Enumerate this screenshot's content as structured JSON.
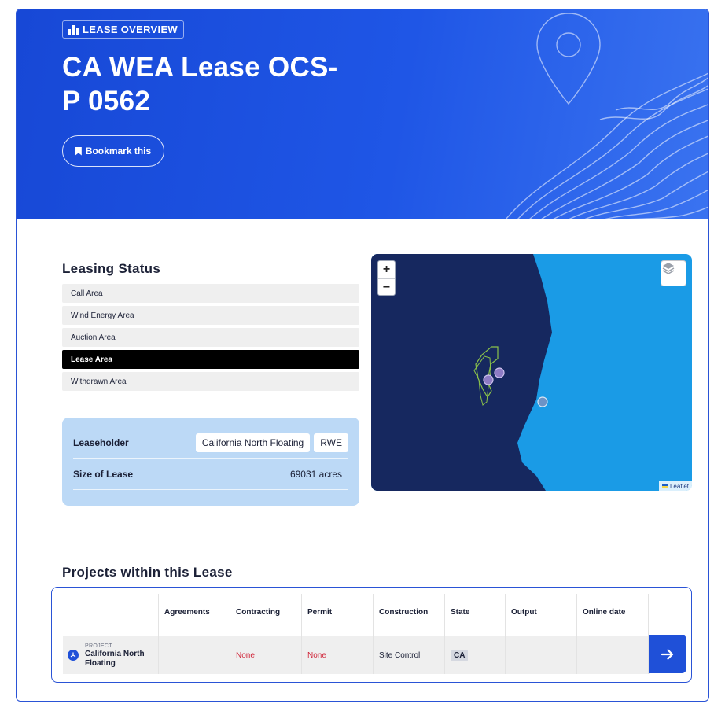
{
  "hero": {
    "chip_label": "LEASE OVERVIEW",
    "title_line1": "CA WEA Lease OCS-",
    "title_line2": "P 0562",
    "bookmark_label": "Bookmark this"
  },
  "leasing_status": {
    "title": "Leasing Status",
    "items": [
      {
        "label": "Call Area",
        "active": false
      },
      {
        "label": "Wind Energy Area",
        "active": false
      },
      {
        "label": "Auction Area",
        "active": false
      },
      {
        "label": "Lease Area",
        "active": true
      },
      {
        "label": "Withdrawn Area",
        "active": false
      }
    ]
  },
  "lease_info": {
    "leaseholder_label": "Leaseholder",
    "leaseholders": [
      "California North Floating",
      "RWE"
    ],
    "size_label": "Size of Lease",
    "size_value": "69031 acres"
  },
  "map": {
    "zoom_in": "+",
    "zoom_out": "−",
    "attribution": "Leaflet",
    "colors": {
      "land": "#16285f",
      "ocean": "#1a9be6",
      "lease_outline": "#8bc34a",
      "marker": "#8e7bc4"
    }
  },
  "projects": {
    "title": "Projects within this Lease",
    "columns": [
      "Agreements",
      "Contracting",
      "Permit",
      "Construction",
      "State",
      "Output",
      "Online date"
    ],
    "rows": [
      {
        "type_label": "PROJECT",
        "name": "California North Floating",
        "agreements": "",
        "contracting": "None",
        "permit": "None",
        "construction": "Site Control",
        "state": "CA",
        "output": "",
        "online_date": ""
      }
    ]
  },
  "colors": {
    "brand": "#1f50d8",
    "hero_gradient_end": "#3a73f0",
    "status_red": "#d0273b",
    "card_bg": "#bcd9f6"
  }
}
